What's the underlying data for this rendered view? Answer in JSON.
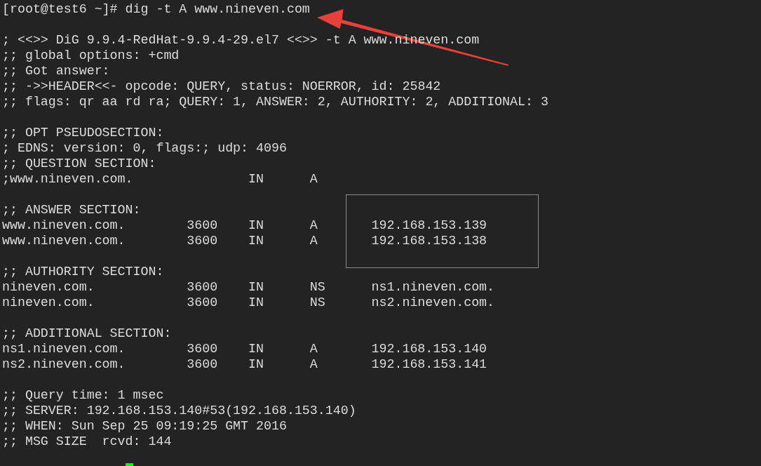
{
  "terminal": {
    "lines": [
      {
        "kind": "text",
        "text": "[root@test6 ~]# dig -t A www.nineven.com"
      },
      {
        "kind": "blank"
      },
      {
        "kind": "text",
        "text": "; <<>> DiG 9.9.4-RedHat-9.9.4-29.el7 <<>> -t A www.nineven.com"
      },
      {
        "kind": "text",
        "text": ";; global options: +cmd"
      },
      {
        "kind": "text",
        "text": ";; Got answer:"
      },
      {
        "kind": "text",
        "text": ";; ->>HEADER<<- opcode: QUERY, status: NOERROR, id: 25842"
      },
      {
        "kind": "text",
        "text": ";; flags: qr aa rd ra; QUERY: 1, ANSWER: 2, AUTHORITY: 2, ADDITIONAL: 3"
      },
      {
        "kind": "blank"
      },
      {
        "kind": "text",
        "text": ";; OPT PSEUDOSECTION:"
      },
      {
        "kind": "text",
        "text": "; EDNS: version: 0, flags:; udp: 4096"
      },
      {
        "kind": "text",
        "text": ";; QUESTION SECTION:"
      },
      {
        "kind": "question",
        "name": ";www.nineven.com.",
        "class": "IN",
        "type": "A"
      },
      {
        "kind": "blank"
      },
      {
        "kind": "text",
        "text": ";; ANSWER SECTION:"
      },
      {
        "kind": "record",
        "name": "www.nineven.com.",
        "ttl": "3600",
        "class": "IN",
        "type": "A",
        "data": "192.168.153.139"
      },
      {
        "kind": "record",
        "name": "www.nineven.com.",
        "ttl": "3600",
        "class": "IN",
        "type": "A",
        "data": "192.168.153.138"
      },
      {
        "kind": "blank"
      },
      {
        "kind": "text",
        "text": ";; AUTHORITY SECTION:"
      },
      {
        "kind": "record",
        "name": "nineven.com.",
        "ttl": "3600",
        "class": "IN",
        "type": "NS",
        "data": "ns1.nineven.com."
      },
      {
        "kind": "record",
        "name": "nineven.com.",
        "ttl": "3600",
        "class": "IN",
        "type": "NS",
        "data": "ns2.nineven.com."
      },
      {
        "kind": "blank"
      },
      {
        "kind": "text",
        "text": ";; ADDITIONAL SECTION:"
      },
      {
        "kind": "record",
        "name": "ns1.nineven.com.",
        "ttl": "3600",
        "class": "IN",
        "type": "A",
        "data": "192.168.153.140"
      },
      {
        "kind": "record",
        "name": "ns2.nineven.com.",
        "ttl": "3600",
        "class": "IN",
        "type": "A",
        "data": "192.168.153.141"
      },
      {
        "kind": "blank"
      },
      {
        "kind": "text",
        "text": ";; Query time: 1 msec"
      },
      {
        "kind": "text",
        "text": ";; SERVER: 192.168.153.140#53(192.168.153.140)"
      },
      {
        "kind": "text",
        "text": ";; WHEN: Sun Sep 25 09:19:25 GMT 2016"
      },
      {
        "kind": "text",
        "text": ";; MSG SIZE  rcvd: 144"
      }
    ]
  }
}
